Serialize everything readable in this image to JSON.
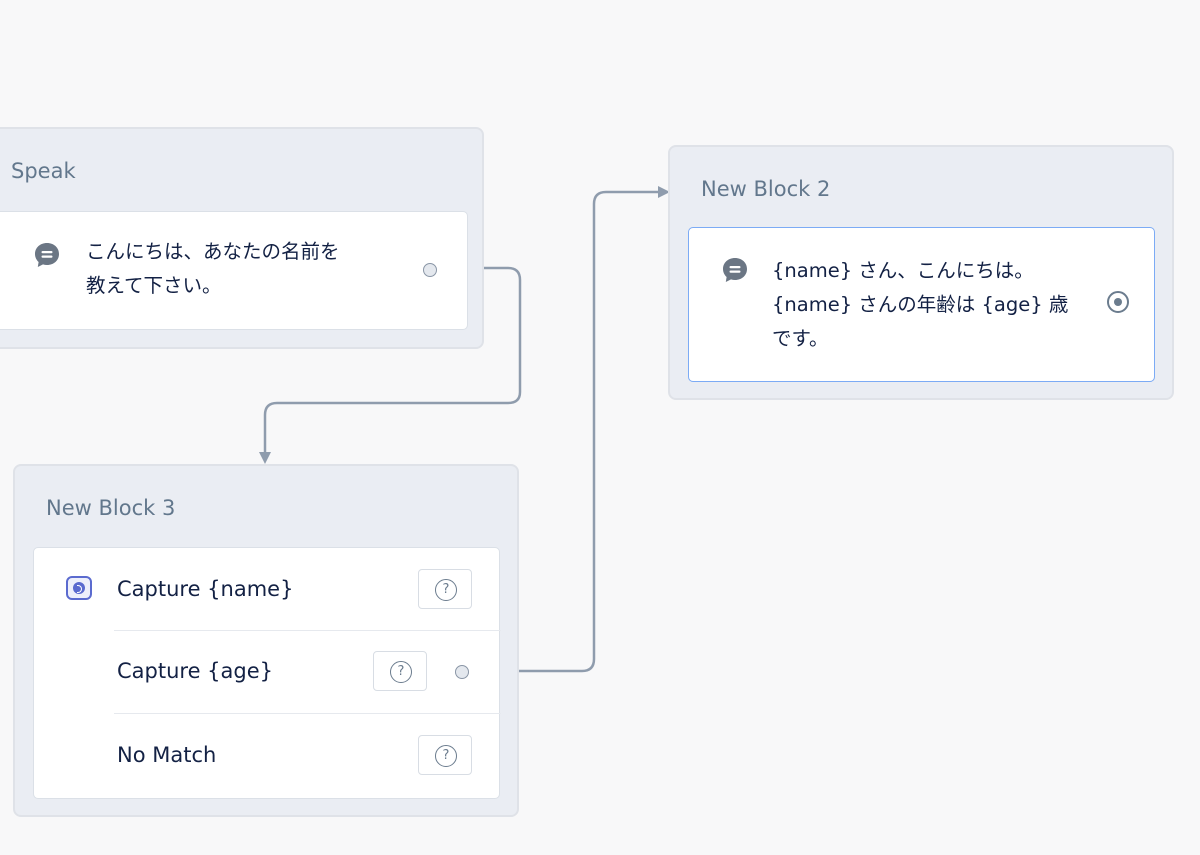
{
  "blocks": {
    "speak": {
      "title": "Speak",
      "text_line1": "こんにちは、あなたの名前を",
      "text_line2": "教えて下さい。",
      "icon": "speak-bubble-icon"
    },
    "new_block_2": {
      "title": "New Block 2",
      "text_line1": "{name} さん、こんにちは。",
      "text_line2": "{name} さんの年齢は {age} 歳",
      "text_line3": "です。",
      "icon": "speak-bubble-icon"
    },
    "new_block_3": {
      "title": "New Block 3",
      "capture_icon": "capture-icon",
      "rows": [
        {
          "label": "Capture {name}",
          "help_glyph": "?"
        },
        {
          "label": "Capture {age}",
          "help_glyph": "?"
        },
        {
          "label": "No Match",
          "help_glyph": "?"
        }
      ]
    }
  },
  "colors": {
    "canvas_bg": "#f8f8f9",
    "block_bg": "#eaedf3",
    "connector": "#8f9cad",
    "selected_border": "#7cabf5",
    "capture_accent": "#5b6bcf"
  }
}
